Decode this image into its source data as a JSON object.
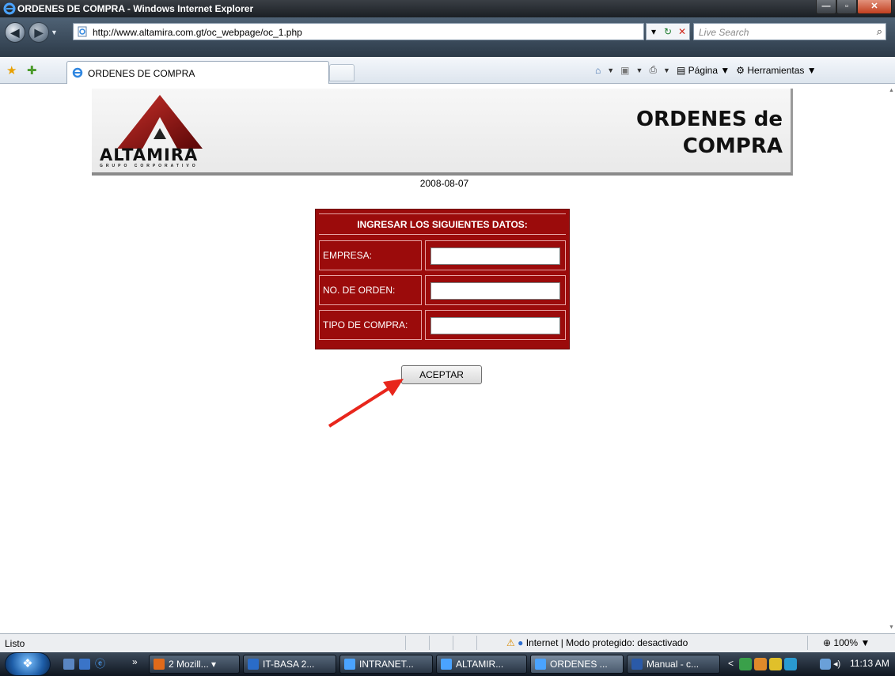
{
  "window": {
    "title": "ORDENES DE COMPRA - Windows Internet Explorer",
    "buttons": {
      "minimize": "—",
      "maximize": "▫",
      "close": "✕"
    }
  },
  "addressbar": {
    "back": "◀",
    "forward": "▶",
    "url": "http://www.altamira.com.gt/oc_webpage/oc_1.php",
    "refresh": "↻",
    "stop": "✕",
    "search_placeholder": "Live Search",
    "search_icon": "⌕"
  },
  "tabbar": {
    "tab_title": "ORDENES DE COMPRA",
    "commands": {
      "page": "Página",
      "tools": "Herramientas"
    },
    "icons": {
      "favorites": "star-icon",
      "add_favorites": "add-star-icon",
      "home": "home-icon",
      "feeds": "rss-icon",
      "print": "print-icon"
    }
  },
  "page": {
    "logo_name": "ALTAMIRA",
    "logo_sub": "GRUPO CORPORATIVO",
    "header_line1": "ORDENES de",
    "header_line2": "COMPRA",
    "date": "2008-08-07",
    "form": {
      "heading": "INGRESAR LOS SIGUIENTES DATOS:",
      "fields": [
        {
          "label": "EMPRESA:",
          "value": ""
        },
        {
          "label": "NO. DE ORDEN:",
          "value": ""
        },
        {
          "label": "TIPO DE COMPRA:",
          "value": ""
        }
      ],
      "submit": "ACEPTAR"
    },
    "annotation_color": "#e8261c",
    "brand_color": "#9b0b0b"
  },
  "statusbar": {
    "status": "Listo",
    "zone": "Internet | Modo protegido: desactivado",
    "zoom": "100%"
  },
  "taskbar": {
    "tasks": [
      {
        "label": "2 Mozill..."
      },
      {
        "label": "IT-BASA 2..."
      },
      {
        "label": "INTRANET..."
      },
      {
        "label": "ALTAMIR..."
      },
      {
        "label": "ORDENES ..."
      },
      {
        "label": "Manual - c..."
      }
    ],
    "clock": "11:13 AM"
  }
}
